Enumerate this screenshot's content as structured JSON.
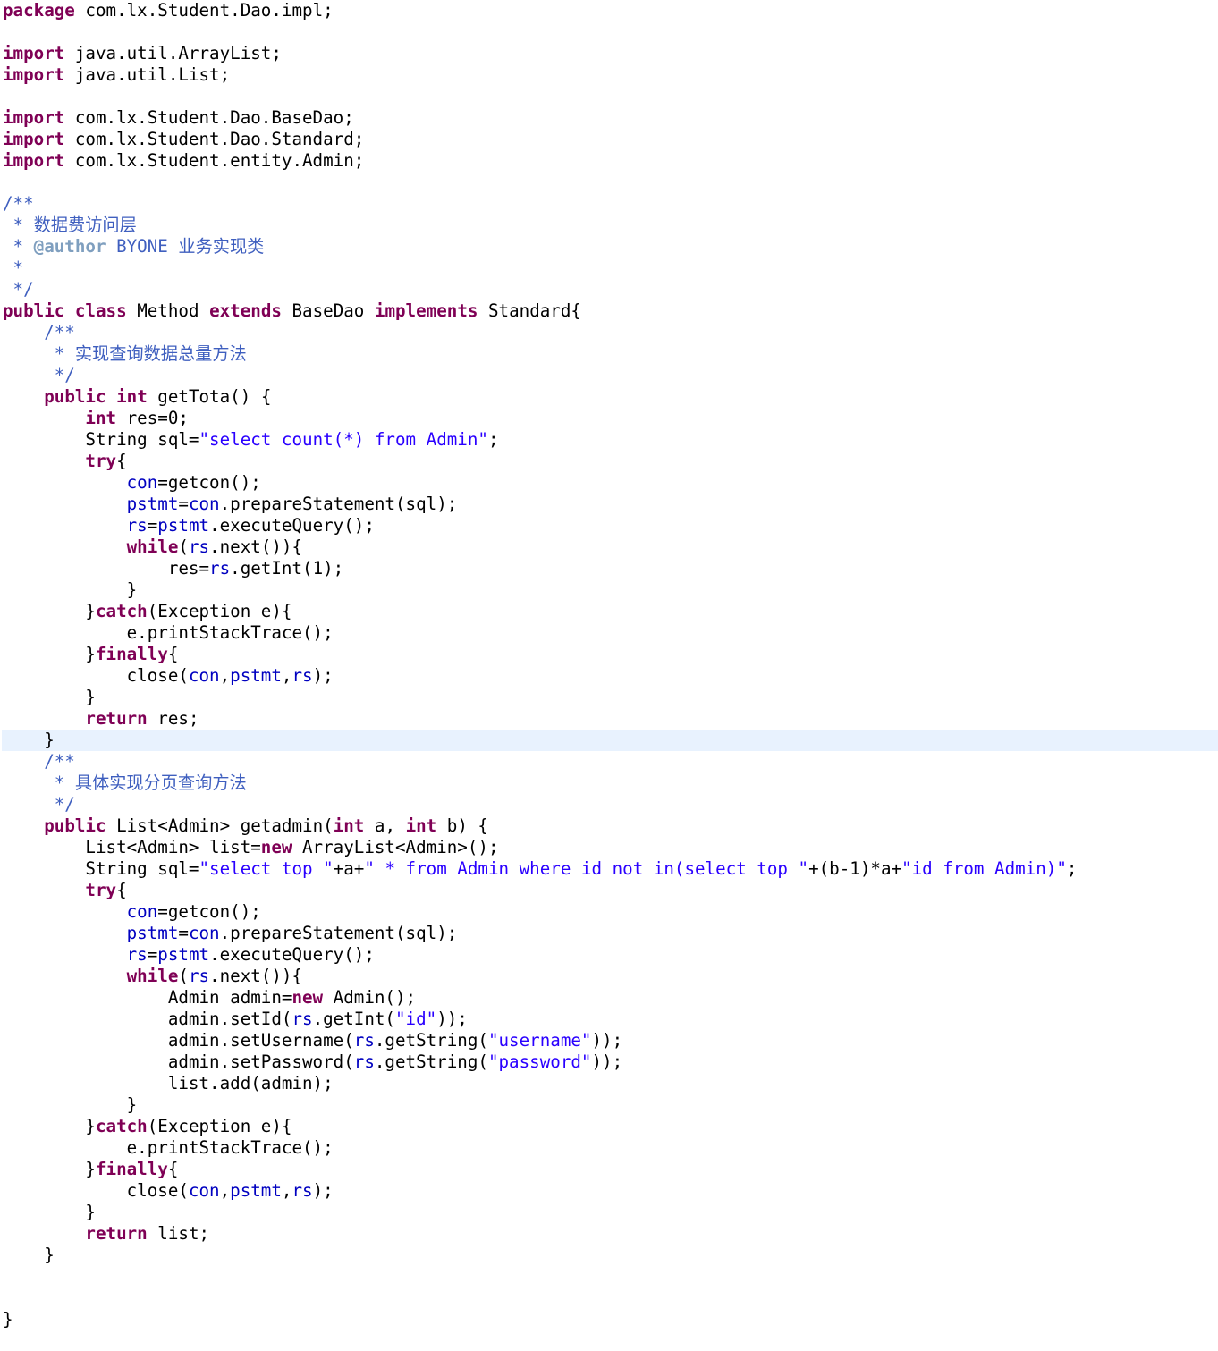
{
  "editor": {
    "language": "java",
    "highlight_line": 34,
    "colors": {
      "keyword": "#7f0055",
      "string": "#2a00ff",
      "field": "#0000c0",
      "javadoc": "#3f5fbf",
      "javadoc_tag": "#7f9fbf",
      "plain": "#000000",
      "current_line": "#e8f2fe"
    },
    "lines": [
      [
        [
          "kw",
          "package"
        ],
        [
          "p",
          " com.lx.Student.Dao.impl;"
        ]
      ],
      [],
      [
        [
          "kw",
          "import"
        ],
        [
          "p",
          " java.util.ArrayList;"
        ]
      ],
      [
        [
          "kw",
          "import"
        ],
        [
          "p",
          " java.util.List;"
        ]
      ],
      [],
      [
        [
          "kw",
          "import"
        ],
        [
          "p",
          " com.lx.Student.Dao.BaseDao;"
        ]
      ],
      [
        [
          "kw",
          "import"
        ],
        [
          "p",
          " com.lx.Student.Dao.Standard;"
        ]
      ],
      [
        [
          "kw",
          "import"
        ],
        [
          "p",
          " com.lx.Student.entity.Admin;"
        ]
      ],
      [],
      [
        [
          "cm",
          "/**"
        ]
      ],
      [
        [
          "cm",
          " * 数据费访问层"
        ]
      ],
      [
        [
          "cm",
          " * "
        ],
        [
          "tag",
          "@author"
        ],
        [
          "cm",
          " BYONE 业务实现类"
        ]
      ],
      [
        [
          "cm",
          " *"
        ]
      ],
      [
        [
          "cm",
          " */"
        ]
      ],
      [
        [
          "kw",
          "public"
        ],
        [
          "p",
          " "
        ],
        [
          "kw",
          "class"
        ],
        [
          "p",
          " Method "
        ],
        [
          "kw",
          "extends"
        ],
        [
          "p",
          " BaseDao "
        ],
        [
          "kw",
          "implements"
        ],
        [
          "p",
          " Standard{"
        ]
      ],
      [
        [
          "cm",
          "    /**"
        ]
      ],
      [
        [
          "cm",
          "     * 实现查询数据总量方法"
        ]
      ],
      [
        [
          "cm",
          "     */"
        ]
      ],
      [
        [
          "p",
          "    "
        ],
        [
          "kw",
          "public"
        ],
        [
          "p",
          " "
        ],
        [
          "kw",
          "int"
        ],
        [
          "p",
          " getTota() {"
        ]
      ],
      [
        [
          "p",
          "        "
        ],
        [
          "kw",
          "int"
        ],
        [
          "p",
          " res=0;"
        ]
      ],
      [
        [
          "p",
          "        String sql="
        ],
        [
          "str",
          "\"select count(*) from Admin\""
        ],
        [
          "p",
          ";"
        ]
      ],
      [
        [
          "p",
          "        "
        ],
        [
          "kw",
          "try"
        ],
        [
          "p",
          "{"
        ]
      ],
      [
        [
          "p",
          "            "
        ],
        [
          "fld",
          "con"
        ],
        [
          "p",
          "=getcon();"
        ]
      ],
      [
        [
          "p",
          "            "
        ],
        [
          "fld",
          "pstmt"
        ],
        [
          "p",
          "="
        ],
        [
          "fld",
          "con"
        ],
        [
          "p",
          ".prepareStatement(sql);"
        ]
      ],
      [
        [
          "p",
          "            "
        ],
        [
          "fld",
          "rs"
        ],
        [
          "p",
          "="
        ],
        [
          "fld",
          "pstmt"
        ],
        [
          "p",
          ".executeQuery();"
        ]
      ],
      [
        [
          "p",
          "            "
        ],
        [
          "kw",
          "while"
        ],
        [
          "p",
          "("
        ],
        [
          "fld",
          "rs"
        ],
        [
          "p",
          ".next()){"
        ]
      ],
      [
        [
          "p",
          "                res="
        ],
        [
          "fld",
          "rs"
        ],
        [
          "p",
          ".getInt(1);"
        ]
      ],
      [
        [
          "p",
          "            }"
        ]
      ],
      [
        [
          "p",
          "        }"
        ],
        [
          "kw",
          "catch"
        ],
        [
          "p",
          "(Exception e){"
        ]
      ],
      [
        [
          "p",
          "            e.printStackTrace();"
        ]
      ],
      [
        [
          "p",
          "        }"
        ],
        [
          "kw",
          "finally"
        ],
        [
          "p",
          "{"
        ]
      ],
      [
        [
          "p",
          "            close("
        ],
        [
          "fld",
          "con"
        ],
        [
          "p",
          ","
        ],
        [
          "fld",
          "pstmt"
        ],
        [
          "p",
          ","
        ],
        [
          "fld",
          "rs"
        ],
        [
          "p",
          ");"
        ]
      ],
      [
        [
          "p",
          "        }"
        ]
      ],
      [
        [
          "p",
          "        "
        ],
        [
          "kw",
          "return"
        ],
        [
          "p",
          " res;"
        ]
      ],
      [
        [
          "p",
          "    }"
        ]
      ],
      [
        [
          "cm",
          "    /**"
        ]
      ],
      [
        [
          "cm",
          "     * 具体实现分页查询方法"
        ]
      ],
      [
        [
          "cm",
          "     */"
        ]
      ],
      [
        [
          "p",
          "    "
        ],
        [
          "kw",
          "public"
        ],
        [
          "p",
          " List<Admin> getadmin("
        ],
        [
          "kw",
          "int"
        ],
        [
          "p",
          " a, "
        ],
        [
          "kw",
          "int"
        ],
        [
          "p",
          " b) {"
        ]
      ],
      [
        [
          "p",
          "        List<Admin> list="
        ],
        [
          "kw",
          "new"
        ],
        [
          "p",
          " ArrayList<Admin>();"
        ]
      ],
      [
        [
          "p",
          "        String sql="
        ],
        [
          "str",
          "\"select top \""
        ],
        [
          "p",
          "+a+"
        ],
        [
          "str",
          "\" * from Admin where id not in(select top \""
        ],
        [
          "p",
          "+(b-1)*a+"
        ],
        [
          "str",
          "\"id from Admin)\""
        ],
        [
          "p",
          ";"
        ]
      ],
      [
        [
          "p",
          "        "
        ],
        [
          "kw",
          "try"
        ],
        [
          "p",
          "{"
        ]
      ],
      [
        [
          "p",
          "            "
        ],
        [
          "fld",
          "con"
        ],
        [
          "p",
          "=getcon();"
        ]
      ],
      [
        [
          "p",
          "            "
        ],
        [
          "fld",
          "pstmt"
        ],
        [
          "p",
          "="
        ],
        [
          "fld",
          "con"
        ],
        [
          "p",
          ".prepareStatement(sql);"
        ]
      ],
      [
        [
          "p",
          "            "
        ],
        [
          "fld",
          "rs"
        ],
        [
          "p",
          "="
        ],
        [
          "fld",
          "pstmt"
        ],
        [
          "p",
          ".executeQuery();"
        ]
      ],
      [
        [
          "p",
          "            "
        ],
        [
          "kw",
          "while"
        ],
        [
          "p",
          "("
        ],
        [
          "fld",
          "rs"
        ],
        [
          "p",
          ".next()){"
        ]
      ],
      [
        [
          "p",
          "                Admin admin="
        ],
        [
          "kw",
          "new"
        ],
        [
          "p",
          " Admin();"
        ]
      ],
      [
        [
          "p",
          "                admin.setId("
        ],
        [
          "fld",
          "rs"
        ],
        [
          "p",
          ".getInt("
        ],
        [
          "str",
          "\"id\""
        ],
        [
          "p",
          "));"
        ]
      ],
      [
        [
          "p",
          "                admin.setUsername("
        ],
        [
          "fld",
          "rs"
        ],
        [
          "p",
          ".getString("
        ],
        [
          "str",
          "\"username\""
        ],
        [
          "p",
          "));"
        ]
      ],
      [
        [
          "p",
          "                admin.setPassword("
        ],
        [
          "fld",
          "rs"
        ],
        [
          "p",
          ".getString("
        ],
        [
          "str",
          "\"password\""
        ],
        [
          "p",
          "));"
        ]
      ],
      [
        [
          "p",
          "                list.add(admin);"
        ]
      ],
      [
        [
          "p",
          "            }"
        ]
      ],
      [
        [
          "p",
          "        }"
        ],
        [
          "kw",
          "catch"
        ],
        [
          "p",
          "(Exception e){"
        ]
      ],
      [
        [
          "p",
          "            e.printStackTrace();"
        ]
      ],
      [
        [
          "p",
          "        }"
        ],
        [
          "kw",
          "finally"
        ],
        [
          "p",
          "{"
        ]
      ],
      [
        [
          "p",
          "            close("
        ],
        [
          "fld",
          "con"
        ],
        [
          "p",
          ","
        ],
        [
          "fld",
          "pstmt"
        ],
        [
          "p",
          ","
        ],
        [
          "fld",
          "rs"
        ],
        [
          "p",
          ");"
        ]
      ],
      [
        [
          "p",
          "        }"
        ]
      ],
      [
        [
          "p",
          "        "
        ],
        [
          "kw",
          "return"
        ],
        [
          "p",
          " list;"
        ]
      ],
      [
        [
          "p",
          "    }"
        ]
      ],
      [],
      [],
      [
        [
          "p",
          "}"
        ]
      ]
    ]
  }
}
